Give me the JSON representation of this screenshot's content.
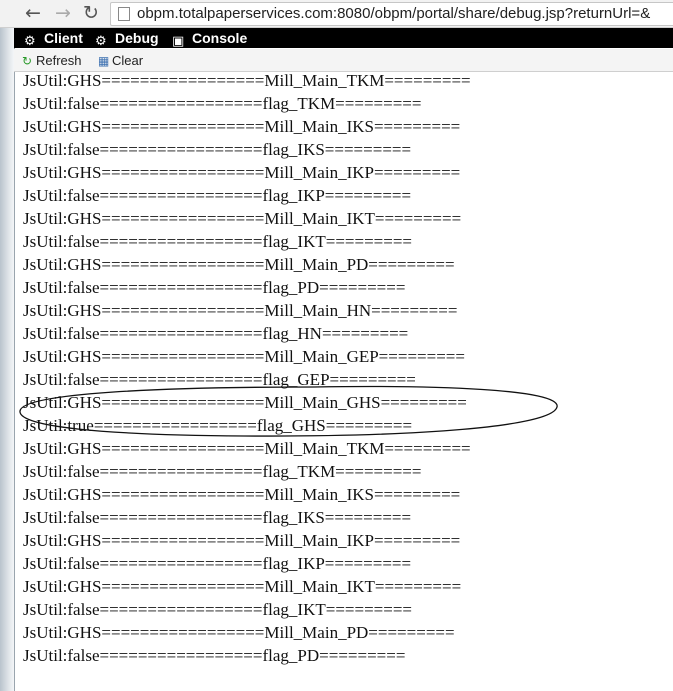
{
  "browser": {
    "url": "obpm.totalpaperservices.com:8080/obpm/portal/share/debug.jsp?returnUrl=&",
    "back_icon": "back-arrow-icon",
    "forward_icon": "forward-arrow-icon",
    "reload_icon": "reload-icon"
  },
  "toolbar": {
    "client_label": "Client",
    "debug_label": "Debug",
    "console_label": "Console"
  },
  "actions": {
    "refresh_label": "Refresh",
    "clear_label": "Clear"
  },
  "log": {
    "lines": [
      "JsUtil:GHS=================Mill_Main_TKM=========",
      "JsUtil:false=================flag_TKM=========",
      "JsUtil:GHS=================Mill_Main_IKS=========",
      "JsUtil:false=================flag_IKS=========",
      "JsUtil:GHS=================Mill_Main_IKP=========",
      "JsUtil:false=================flag_IKP=========",
      "JsUtil:GHS=================Mill_Main_IKT=========",
      "JsUtil:false=================flag_IKT=========",
      "JsUtil:GHS=================Mill_Main_PD=========",
      "JsUtil:false=================flag_PD=========",
      "JsUtil:GHS=================Mill_Main_HN=========",
      "JsUtil:false=================flag_HN=========",
      "JsUtil:GHS=================Mill_Main_GEP=========",
      "JsUtil:false=================flag_GEP=========",
      "JsUtil:GHS=================Mill_Main_GHS=========",
      "JsUtil:true=================flag_GHS=========",
      "JsUtil:GHS=================Mill_Main_TKM=========",
      "JsUtil:false=================flag_TKM=========",
      "JsUtil:GHS=================Mill_Main_IKS=========",
      "JsUtil:false=================flag_IKS=========",
      "JsUtil:GHS=================Mill_Main_IKP=========",
      "JsUtil:false=================flag_IKP=========",
      "JsUtil:GHS=================Mill_Main_IKT=========",
      "JsUtil:false=================flag_IKT=========",
      "JsUtil:GHS=================Mill_Main_PD=========",
      "JsUtil:false=================flag_PD========="
    ]
  },
  "colors": {
    "toolbar_bg": "#000000",
    "annotation_stroke": "#111111"
  }
}
